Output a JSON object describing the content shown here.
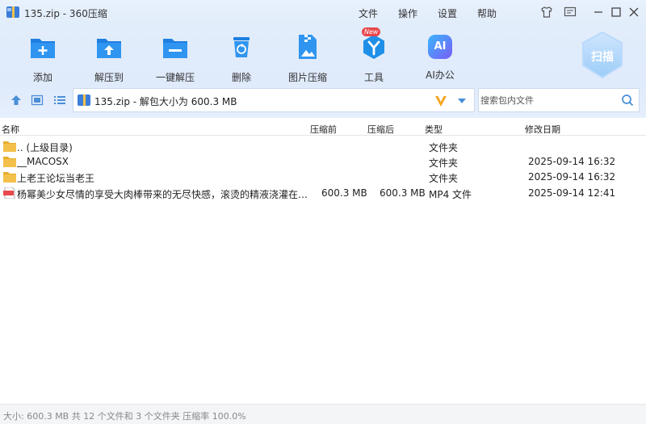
{
  "window": {
    "title": "135.zip - 360压缩"
  },
  "menu": [
    "文件",
    "操作",
    "设置",
    "帮助"
  ],
  "toolbar": {
    "items": [
      {
        "label": "添加",
        "icon": "add-icon"
      },
      {
        "label": "解压到",
        "icon": "extract-to-icon"
      },
      {
        "label": "一键解压",
        "icon": "one-click-extract-icon"
      },
      {
        "label": "删除",
        "icon": "delete-icon"
      },
      {
        "label": "图片压缩",
        "icon": "image-compress-icon"
      },
      {
        "label": "工具",
        "icon": "tools-icon",
        "badge": "New"
      },
      {
        "label": "AI办公",
        "icon": "ai-office-icon",
        "icon_text": "AI"
      }
    ],
    "scan_label": "扫描"
  },
  "address": {
    "path": "135.zip - 解包大小为 600.3 MB"
  },
  "search": {
    "placeholder": "搜索包内文件"
  },
  "columns": {
    "name": "名称",
    "packed": "压缩前",
    "unpacked": "压缩后",
    "type": "类型",
    "modified": "修改日期"
  },
  "files": [
    {
      "name": ".. (上级目录)",
      "packed": "",
      "unpacked": "",
      "type": "文件夹",
      "modified": "",
      "icon": "folder-icon"
    },
    {
      "name": "__MACOSX",
      "packed": "",
      "unpacked": "",
      "type": "文件夹",
      "modified": "2025-09-14 16:32",
      "icon": "folder-icon"
    },
    {
      "name": "上老王论坛当老王",
      "packed": "",
      "unpacked": "",
      "type": "文件夹",
      "modified": "2025-09-14 16:32",
      "icon": "folder-icon"
    },
    {
      "name": "杨幂美少女尽情的享受大肉棒带来的无尽快感，滚烫的精液浇灌在她...",
      "packed": "600.3 MB",
      "unpacked": "600.3 MB",
      "type": "MP4 文件",
      "modified": "2025-09-14 12:41",
      "icon": "mp4-file-icon"
    }
  ],
  "status": {
    "text": "大小: 600.3 MB 共 12 个文件和 3 个文件夹 压缩率 100.0%"
  },
  "colors": {
    "accent": "#2a8ae6",
    "orange": "#f5a623",
    "folder": "#f3c14b"
  }
}
